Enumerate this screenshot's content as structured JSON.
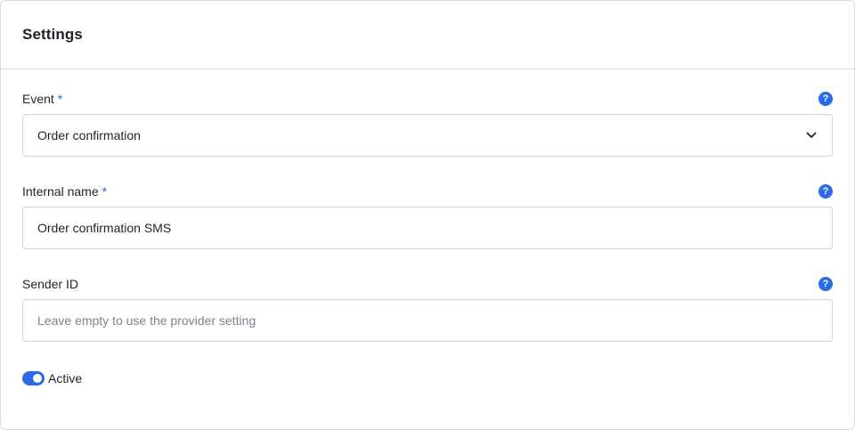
{
  "card": {
    "title": "Settings"
  },
  "fields": {
    "event": {
      "label": "Event",
      "required_mark": "*",
      "value": "Order confirmation"
    },
    "internal_name": {
      "label": "Internal name",
      "required_mark": "*",
      "value": "Order confirmation SMS"
    },
    "sender_id": {
      "label": "Sender ID",
      "value": "",
      "placeholder": "Leave empty to use the provider setting"
    }
  },
  "help_icon_glyph": "?",
  "active_toggle": {
    "label": "Active",
    "checked": true
  },
  "colors": {
    "accent": "#2b6bea",
    "border": "#d8dde3",
    "text": "#1f2329",
    "placeholder": "#7d848c"
  }
}
